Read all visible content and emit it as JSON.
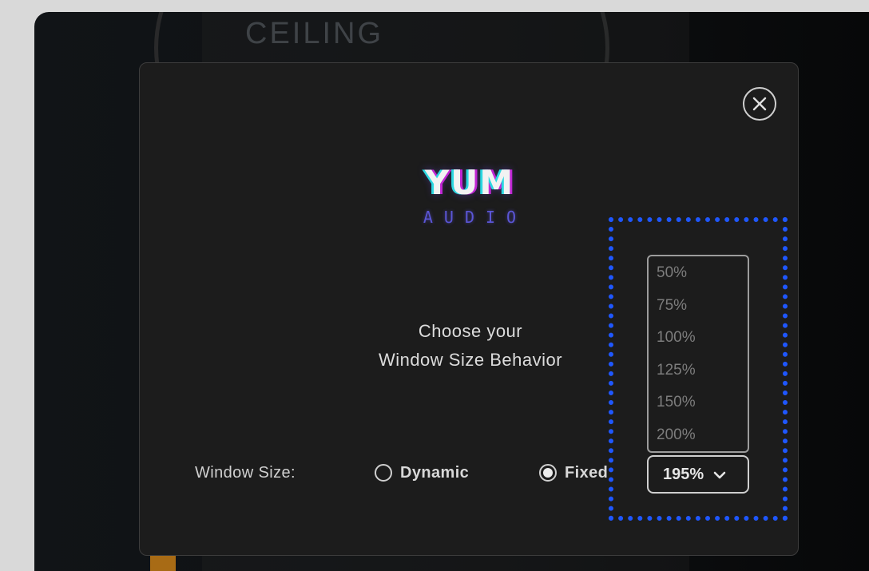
{
  "background": {
    "knob_label": "CEILING"
  },
  "dialog": {
    "close_icon": "close-circle-icon",
    "logo": {
      "mark": "YUM",
      "sub": "AUDIO"
    },
    "heading_line1": "Choose your",
    "heading_line2": "Window Size Behavior",
    "window_size_label": "Window Size:",
    "radio_options": [
      {
        "label": "Dynamic",
        "checked": false
      },
      {
        "label": "Fixed",
        "checked": true
      }
    ],
    "size_dropdown": {
      "selected": "195%",
      "options": [
        "50%",
        "75%",
        "100%",
        "125%",
        "150%",
        "200%"
      ],
      "chevron_icon": "chevron-down-icon"
    }
  },
  "colors": {
    "highlight_dots": "#1f57ff",
    "dialog_bg": "#1c1c1c",
    "logo_purple": "#5b56d6",
    "logo_cyan": "#2ad7e0",
    "logo_magenta": "#c026d3"
  }
}
